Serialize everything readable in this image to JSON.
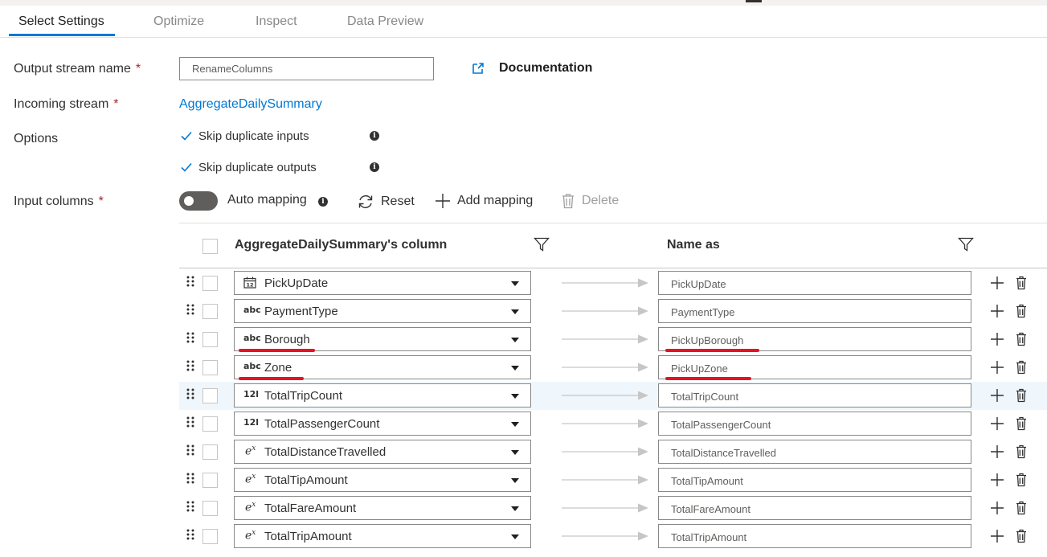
{
  "tabs": [
    {
      "label": "Select Settings",
      "active": true
    },
    {
      "label": "Optimize",
      "active": false
    },
    {
      "label": "Inspect",
      "active": false
    },
    {
      "label": "Data Preview",
      "active": false
    }
  ],
  "form": {
    "output_stream_label": "Output stream name",
    "output_stream_value": "RenameColumns",
    "incoming_stream_label": "Incoming stream",
    "incoming_stream_value": "AggregateDailySummary",
    "options_label": "Options",
    "input_columns_label": "Input columns",
    "required_marker": "*",
    "documentation_label": "Documentation"
  },
  "options": [
    {
      "label": "Skip duplicate inputs",
      "checked": true
    },
    {
      "label": "Skip duplicate outputs",
      "checked": true
    }
  ],
  "toolbar": {
    "auto_mapping_label": "Auto mapping",
    "auto_mapping_on": false,
    "reset_label": "Reset",
    "add_mapping_label": "Add mapping",
    "delete_label": "Delete",
    "info_glyph": "i"
  },
  "grid": {
    "source_header": "AggregateDailySummary's column",
    "target_header": "Name as",
    "rows": [
      {
        "type": "date",
        "type_glyph": "12",
        "source": "PickUpDate",
        "target": "PickUpDate"
      },
      {
        "type": "string",
        "type_glyph": "abc",
        "source": "PaymentType",
        "target": "PaymentType"
      },
      {
        "type": "string",
        "type_glyph": "abc",
        "source": "Borough",
        "target": "PickUpBorough"
      },
      {
        "type": "string",
        "type_glyph": "abc",
        "source": "Zone",
        "target": "PickUpZone"
      },
      {
        "type": "integer",
        "type_glyph": "12l",
        "source": "TotalTripCount",
        "target": "TotalTripCount"
      },
      {
        "type": "integer",
        "type_glyph": "12l",
        "source": "TotalPassengerCount",
        "target": "TotalPassengerCount"
      },
      {
        "type": "decimal",
        "type_glyph": "ex",
        "source": "TotalDistanceTravelled",
        "target": "TotalDistanceTravelled"
      },
      {
        "type": "decimal",
        "type_glyph": "ex",
        "source": "TotalTipAmount",
        "target": "TotalTipAmount"
      },
      {
        "type": "decimal",
        "type_glyph": "ex",
        "source": "TotalFareAmount",
        "target": "TotalFareAmount"
      },
      {
        "type": "decimal",
        "type_glyph": "ex",
        "source": "TotalTripAmount",
        "target": "TotalTripAmount"
      }
    ]
  },
  "colors": {
    "accent": "#0078d4",
    "required": "#a4262c",
    "annotation": "#e81123",
    "highlight_row": "#eff6fc"
  }
}
